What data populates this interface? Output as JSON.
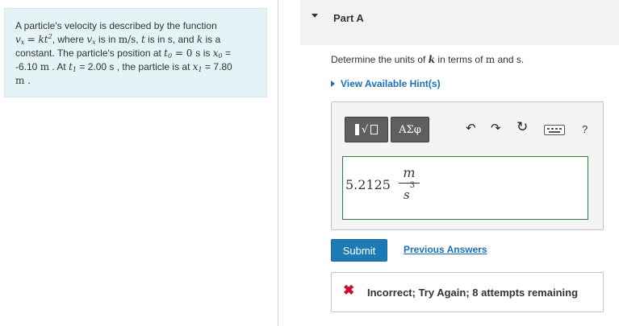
{
  "problem": {
    "line1": "A particle's velocity is described by the function",
    "vx": "v",
    "x_sub": "x",
    "eq_k": "= kt",
    "exp2": "2",
    "where": ", where ",
    "vx2": "v",
    "x_sub2": "x",
    "is_in": " is in ",
    "ms": "m/s",
    "comma_t": ", ",
    "t": "t",
    "t_is_in": " is in s, and ",
    "k": "k",
    "is_a": " is a",
    "line3a": "constant. The particle's position at ",
    "t0": "t",
    "sub0": "0",
    "eq0s": " = 0 s",
    "is": " is ",
    "x0": "x",
    "sub0b": "0",
    "eq_tail": " =",
    "line4a": "-6.10 ",
    "m1": "m",
    "line4b": " . At ",
    "t1": "t",
    "sub1": "1",
    "line4c": " = 2.00 s , the particle is at ",
    "x1": "x",
    "sub1b": "1",
    "line4d": " = 7.80",
    "line5": "m ."
  },
  "part": {
    "title": "Part A"
  },
  "question": {
    "pre": "Determine the units of ",
    "k": "k",
    "mid": " in terms of ",
    "m": "m",
    "post": " and s."
  },
  "hint": {
    "label": "View Available Hint(s)"
  },
  "toolbar": {
    "radical": "√",
    "greek": "ΑΣφ",
    "undo": "↶",
    "redo": "↷",
    "reset": "↻",
    "help": "?"
  },
  "answer": {
    "value": "5.2125",
    "numerator": "m",
    "denominator": "s",
    "exponent": "3"
  },
  "submit_label": "Submit",
  "previous_answers_label": "Previous Answers",
  "feedback": {
    "icon": "✖",
    "message": "Incorrect; Try Again; 8 attempts remaining"
  }
}
